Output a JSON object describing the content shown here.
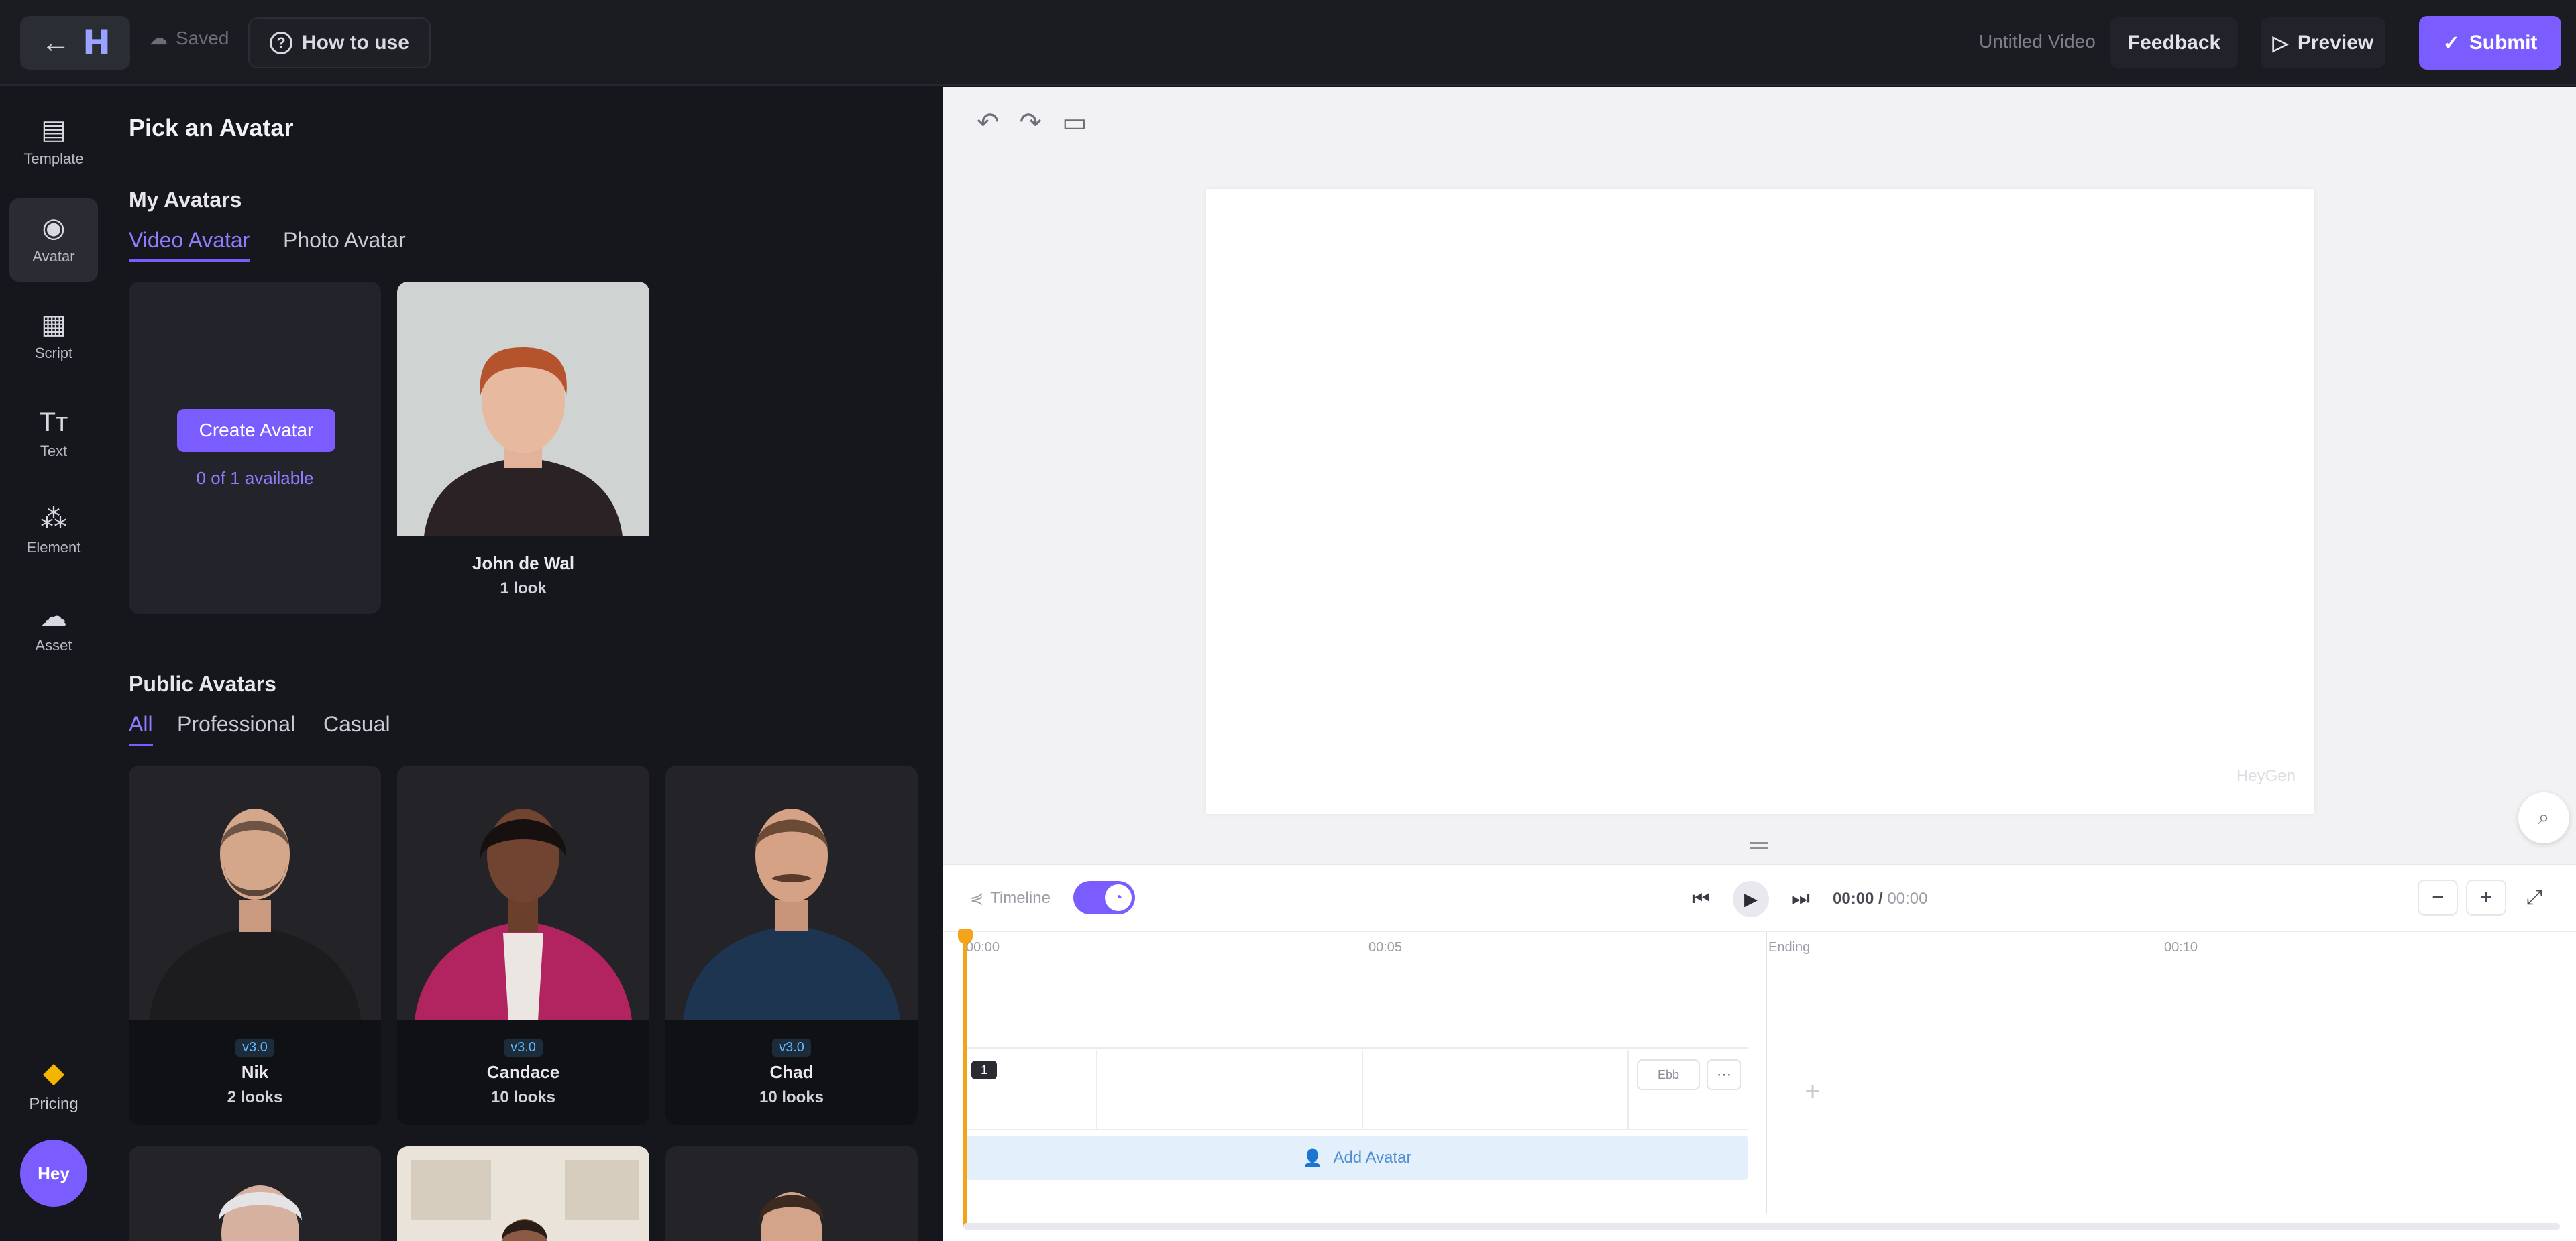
{
  "topbar": {
    "saved_label": "Saved",
    "how_to_use_label": "How to use",
    "video_title": "Untitled Video",
    "feedback_label": "Feedback",
    "preview_label": "Preview",
    "submit_label": "Submit"
  },
  "rail": {
    "items": [
      {
        "label": "Template",
        "icon": "▤"
      },
      {
        "label": "Avatar",
        "icon": "◉"
      },
      {
        "label": "Script",
        "icon": "▦"
      },
      {
        "label": "Text",
        "icon": "Tт"
      },
      {
        "label": "Element",
        "icon": "⁂"
      },
      {
        "label": "Asset",
        "icon": "☁"
      }
    ],
    "pricing_label": "Pricing",
    "profile_label": "Hey"
  },
  "panel": {
    "title": "Pick an Avatar",
    "my_avatars_title": "My Avatars",
    "my_tabs": [
      "Video Avatar",
      "Photo Avatar"
    ],
    "create_label": "Create Avatar",
    "available_label": "0 of 1 available",
    "my_cards": [
      {
        "name": "John de Wal",
        "looks": "1 look"
      }
    ],
    "public_title": "Public Avatars",
    "public_tabs": [
      "All",
      "Professional",
      "Casual"
    ],
    "public_cards": [
      {
        "badge": "v3.0",
        "name": "Nik",
        "looks": "2 looks"
      },
      {
        "badge": "v3.0",
        "name": "Candace",
        "looks": "10 looks"
      },
      {
        "badge": "v3.0",
        "name": "Chad",
        "looks": "10 looks"
      }
    ]
  },
  "workspace": {
    "watermark": "HeyGen"
  },
  "timeline": {
    "label": "Timeline",
    "time_current": "00:00",
    "time_total": "00:00",
    "ruler_marks": [
      "00:00",
      "00:05",
      "Ending",
      "00:10"
    ],
    "clip_number": "1",
    "clip_tag": "Ebb",
    "add_avatar_label": "Add Avatar"
  }
}
